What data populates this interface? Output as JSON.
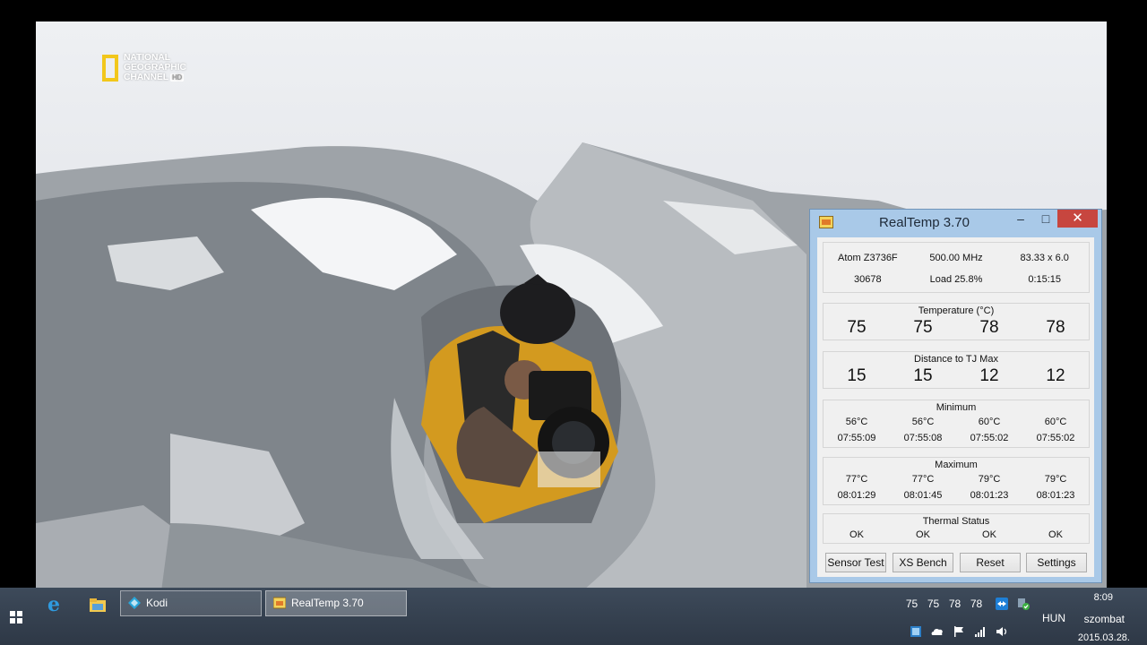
{
  "video": {
    "logo_lines": [
      "NATIONAL",
      "GEOGRAPHIC",
      "CHANNEL"
    ],
    "logo_badge": "HD"
  },
  "realtemp": {
    "title": "RealTemp 3.70",
    "window_controls": {
      "minimize": "–",
      "maximize": "□",
      "close": "✕"
    },
    "info": {
      "cpu": "Atom Z3736F",
      "frequency": "500.00 MHz",
      "multiplier": "83.33 x 6.0",
      "vid": "30678",
      "load": "Load  25.8%",
      "uptime": "0:15:15"
    },
    "temperature": {
      "title": "Temperature (°C)",
      "values": [
        "75",
        "75",
        "78",
        "78"
      ]
    },
    "distance": {
      "title": "Distance to TJ Max",
      "values": [
        "15",
        "15",
        "12",
        "12"
      ]
    },
    "minimum": {
      "title": "Minimum",
      "temps": [
        "56°C",
        "56°C",
        "60°C",
        "60°C"
      ],
      "times": [
        "07:55:09",
        "07:55:08",
        "07:55:02",
        "07:55:02"
      ]
    },
    "maximum": {
      "title": "Maximum",
      "temps": [
        "77°C",
        "77°C",
        "79°C",
        "79°C"
      ],
      "times": [
        "08:01:29",
        "08:01:45",
        "08:01:23",
        "08:01:23"
      ]
    },
    "thermal": {
      "title": "Thermal Status",
      "values": [
        "OK",
        "OK",
        "OK",
        "OK"
      ]
    },
    "buttons": [
      "Sensor Test",
      "XS Bench",
      "Reset",
      "Settings"
    ]
  },
  "taskbar": {
    "tasks": [
      {
        "label": "Kodi",
        "active": false
      },
      {
        "label": "RealTemp 3.70",
        "active": true
      }
    ],
    "tray_temps": [
      "75",
      "75",
      "78",
      "78"
    ],
    "language": "HUN",
    "time": "8:09",
    "day": "szombat",
    "date": "2015.03.28."
  },
  "colors": {
    "title_bar": "#a9c9e8",
    "close_button": "#c7463f",
    "taskbar": "#344150",
    "ng_yellow": "#f2c71c"
  }
}
